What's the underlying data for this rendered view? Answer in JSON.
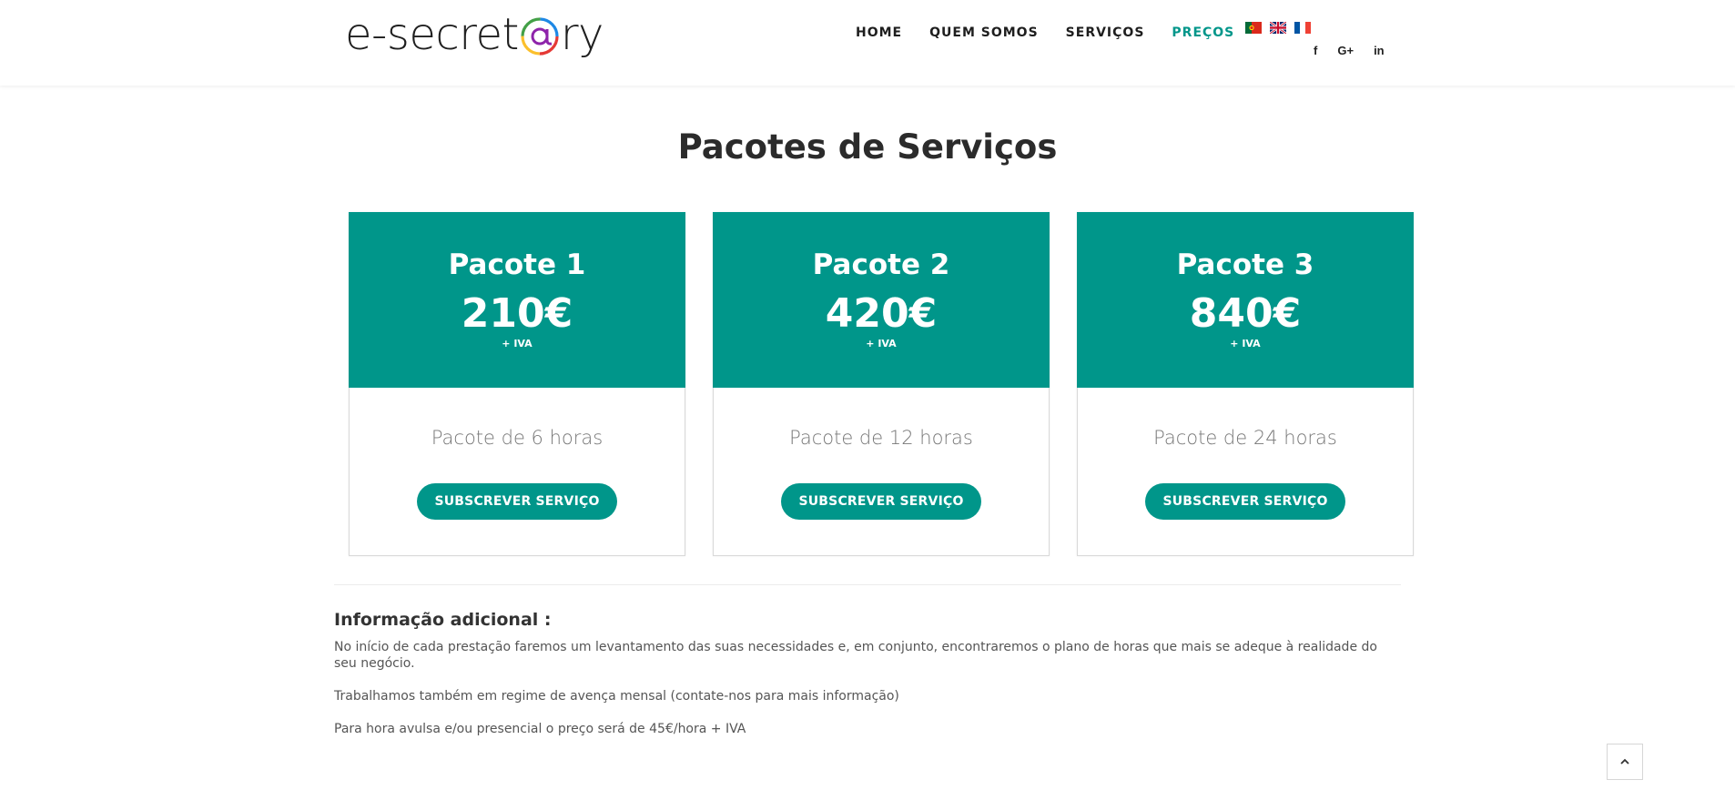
{
  "header": {
    "logo_before": "e-secret",
    "logo_after": "ry",
    "nav": [
      {
        "label": "HOME"
      },
      {
        "label": "QUEM SOMOS"
      },
      {
        "label": "SERVIÇOS"
      },
      {
        "label": "PREÇOS",
        "active": true
      }
    ],
    "flags": [
      "portugal-flag-icon",
      "uk-flag-icon",
      "france-flag-icon"
    ],
    "social": [
      {
        "icon": "facebook-icon",
        "glyph": "f"
      },
      {
        "icon": "google-plus-icon",
        "glyph": "G+"
      },
      {
        "icon": "linkedin-icon",
        "glyph": "in"
      }
    ]
  },
  "main": {
    "title": "Pacotes de Serviços",
    "packages": [
      {
        "name": "Pacote 1",
        "price": "210€",
        "vat": "+ IVA",
        "desc": "Pacote de 6 horas",
        "button": "SUBSCREVER SERVIÇO"
      },
      {
        "name": "Pacote 2",
        "price": "420€",
        "vat": "+ IVA",
        "desc": "Pacote de 12 horas",
        "button": "SUBSCREVER SERVIÇO"
      },
      {
        "name": "Pacote 3",
        "price": "840€",
        "vat": "+ IVA",
        "desc": "Pacote de 24 horas",
        "button": "SUBSCREVER SERVIÇO"
      }
    ],
    "info": {
      "title": "Informação adicional :",
      "paragraphs": [
        "No início de cada prestação faremos um levantamento das suas necessidades e, em conjunto, encontraremos o plano de horas que mais se adeque à realidade do seu negócio.",
        "Trabalhamos também em regime de avença mensal (contate-nos para mais informação)",
        "Para hora avulsa e/ou presencial o preço será de 45€/hora + IVA"
      ]
    }
  },
  "colors": {
    "accent": "#00968a",
    "text": "#333333"
  }
}
